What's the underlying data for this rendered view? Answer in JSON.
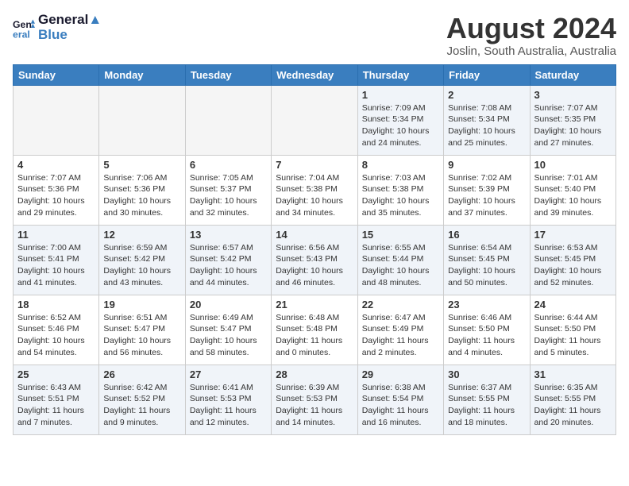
{
  "header": {
    "logo_line1": "General",
    "logo_line2": "Blue",
    "month_year": "August 2024",
    "location": "Joslin, South Australia, Australia"
  },
  "weekdays": [
    "Sunday",
    "Monday",
    "Tuesday",
    "Wednesday",
    "Thursday",
    "Friday",
    "Saturday"
  ],
  "weeks": [
    [
      {
        "day": "",
        "info": ""
      },
      {
        "day": "",
        "info": ""
      },
      {
        "day": "",
        "info": ""
      },
      {
        "day": "",
        "info": ""
      },
      {
        "day": "1",
        "info": "Sunrise: 7:09 AM\nSunset: 5:34 PM\nDaylight: 10 hours\nand 24 minutes."
      },
      {
        "day": "2",
        "info": "Sunrise: 7:08 AM\nSunset: 5:34 PM\nDaylight: 10 hours\nand 25 minutes."
      },
      {
        "day": "3",
        "info": "Sunrise: 7:07 AM\nSunset: 5:35 PM\nDaylight: 10 hours\nand 27 minutes."
      }
    ],
    [
      {
        "day": "4",
        "info": "Sunrise: 7:07 AM\nSunset: 5:36 PM\nDaylight: 10 hours\nand 29 minutes."
      },
      {
        "day": "5",
        "info": "Sunrise: 7:06 AM\nSunset: 5:36 PM\nDaylight: 10 hours\nand 30 minutes."
      },
      {
        "day": "6",
        "info": "Sunrise: 7:05 AM\nSunset: 5:37 PM\nDaylight: 10 hours\nand 32 minutes."
      },
      {
        "day": "7",
        "info": "Sunrise: 7:04 AM\nSunset: 5:38 PM\nDaylight: 10 hours\nand 34 minutes."
      },
      {
        "day": "8",
        "info": "Sunrise: 7:03 AM\nSunset: 5:38 PM\nDaylight: 10 hours\nand 35 minutes."
      },
      {
        "day": "9",
        "info": "Sunrise: 7:02 AM\nSunset: 5:39 PM\nDaylight: 10 hours\nand 37 minutes."
      },
      {
        "day": "10",
        "info": "Sunrise: 7:01 AM\nSunset: 5:40 PM\nDaylight: 10 hours\nand 39 minutes."
      }
    ],
    [
      {
        "day": "11",
        "info": "Sunrise: 7:00 AM\nSunset: 5:41 PM\nDaylight: 10 hours\nand 41 minutes."
      },
      {
        "day": "12",
        "info": "Sunrise: 6:59 AM\nSunset: 5:42 PM\nDaylight: 10 hours\nand 43 minutes."
      },
      {
        "day": "13",
        "info": "Sunrise: 6:57 AM\nSunset: 5:42 PM\nDaylight: 10 hours\nand 44 minutes."
      },
      {
        "day": "14",
        "info": "Sunrise: 6:56 AM\nSunset: 5:43 PM\nDaylight: 10 hours\nand 46 minutes."
      },
      {
        "day": "15",
        "info": "Sunrise: 6:55 AM\nSunset: 5:44 PM\nDaylight: 10 hours\nand 48 minutes."
      },
      {
        "day": "16",
        "info": "Sunrise: 6:54 AM\nSunset: 5:45 PM\nDaylight: 10 hours\nand 50 minutes."
      },
      {
        "day": "17",
        "info": "Sunrise: 6:53 AM\nSunset: 5:45 PM\nDaylight: 10 hours\nand 52 minutes."
      }
    ],
    [
      {
        "day": "18",
        "info": "Sunrise: 6:52 AM\nSunset: 5:46 PM\nDaylight: 10 hours\nand 54 minutes."
      },
      {
        "day": "19",
        "info": "Sunrise: 6:51 AM\nSunset: 5:47 PM\nDaylight: 10 hours\nand 56 minutes."
      },
      {
        "day": "20",
        "info": "Sunrise: 6:49 AM\nSunset: 5:47 PM\nDaylight: 10 hours\nand 58 minutes."
      },
      {
        "day": "21",
        "info": "Sunrise: 6:48 AM\nSunset: 5:48 PM\nDaylight: 11 hours\nand 0 minutes."
      },
      {
        "day": "22",
        "info": "Sunrise: 6:47 AM\nSunset: 5:49 PM\nDaylight: 11 hours\nand 2 minutes."
      },
      {
        "day": "23",
        "info": "Sunrise: 6:46 AM\nSunset: 5:50 PM\nDaylight: 11 hours\nand 4 minutes."
      },
      {
        "day": "24",
        "info": "Sunrise: 6:44 AM\nSunset: 5:50 PM\nDaylight: 11 hours\nand 5 minutes."
      }
    ],
    [
      {
        "day": "25",
        "info": "Sunrise: 6:43 AM\nSunset: 5:51 PM\nDaylight: 11 hours\nand 7 minutes."
      },
      {
        "day": "26",
        "info": "Sunrise: 6:42 AM\nSunset: 5:52 PM\nDaylight: 11 hours\nand 9 minutes."
      },
      {
        "day": "27",
        "info": "Sunrise: 6:41 AM\nSunset: 5:53 PM\nDaylight: 11 hours\nand 12 minutes."
      },
      {
        "day": "28",
        "info": "Sunrise: 6:39 AM\nSunset: 5:53 PM\nDaylight: 11 hours\nand 14 minutes."
      },
      {
        "day": "29",
        "info": "Sunrise: 6:38 AM\nSunset: 5:54 PM\nDaylight: 11 hours\nand 16 minutes."
      },
      {
        "day": "30",
        "info": "Sunrise: 6:37 AM\nSunset: 5:55 PM\nDaylight: 11 hours\nand 18 minutes."
      },
      {
        "day": "31",
        "info": "Sunrise: 6:35 AM\nSunset: 5:55 PM\nDaylight: 11 hours\nand 20 minutes."
      }
    ]
  ]
}
